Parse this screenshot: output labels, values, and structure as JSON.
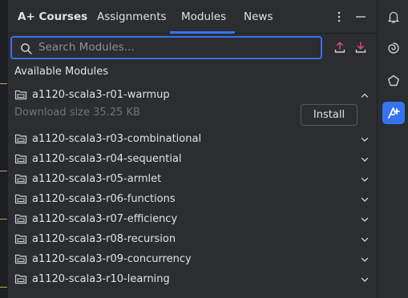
{
  "header": {
    "title": "A+ Courses",
    "tabs": [
      {
        "label": "Assignments",
        "active": false
      },
      {
        "label": "Modules",
        "active": true
      },
      {
        "label": "News",
        "active": false
      }
    ],
    "icons": [
      "more-vertical-icon",
      "minimize-icon"
    ]
  },
  "search": {
    "placeholder": "Search Modules..."
  },
  "actions": [
    "export-icon",
    "import-icon"
  ],
  "section_title": "Available Modules",
  "modules": [
    {
      "name": "a1120-scala3-r01-warmup",
      "expanded": true,
      "download_size": "Download size 35.25 KB",
      "install_label": "Install"
    },
    {
      "name": "a1120-scala3-r03-combinational",
      "expanded": false
    },
    {
      "name": "a1120-scala3-r04-sequential",
      "expanded": false
    },
    {
      "name": "a1120-scala3-r05-armlet",
      "expanded": false
    },
    {
      "name": "a1120-scala3-r06-functions",
      "expanded": false
    },
    {
      "name": "a1120-scala3-r07-efficiency",
      "expanded": false
    },
    {
      "name": "a1120-scala3-r08-recursion",
      "expanded": false
    },
    {
      "name": "a1120-scala3-r09-concurrency",
      "expanded": false
    },
    {
      "name": "a1120-scala3-r10-learning",
      "expanded": false
    }
  ],
  "right_toolbar": [
    "notifications-icon",
    "ai-assistant-icon",
    "plugin-icon",
    "aplus-courses-icon"
  ],
  "colors": {
    "background": "#2b2d30",
    "accent": "#3574f0",
    "text": "#dfe1e5",
    "muted": "#6f737a"
  }
}
